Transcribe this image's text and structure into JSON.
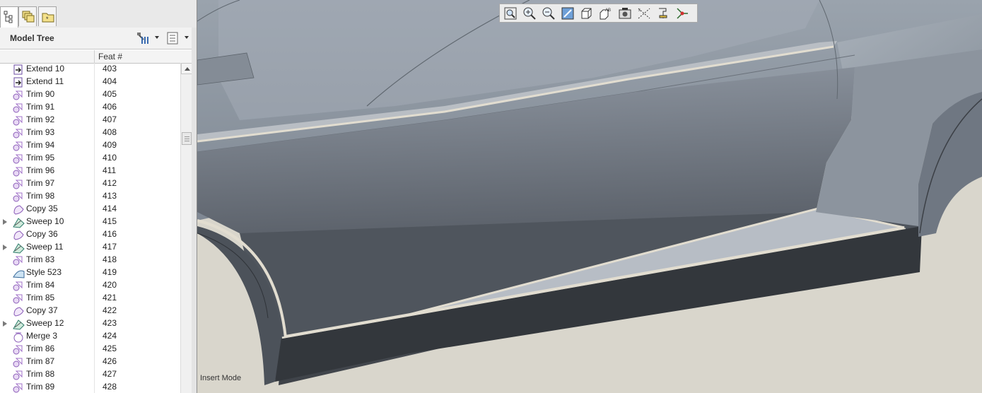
{
  "model_tree": {
    "title": "Model Tree",
    "column_header": "Feat #",
    "rows": [
      {
        "name": "Extend 10",
        "feat": "403",
        "icon": "extend-icon",
        "expandable": false
      },
      {
        "name": "Extend 11",
        "feat": "404",
        "icon": "extend-icon",
        "expandable": false
      },
      {
        "name": "Trim 90",
        "feat": "405",
        "icon": "trim-icon",
        "expandable": false
      },
      {
        "name": "Trim 91",
        "feat": "406",
        "icon": "trim-icon",
        "expandable": false
      },
      {
        "name": "Trim 92",
        "feat": "407",
        "icon": "trim-icon",
        "expandable": false
      },
      {
        "name": "Trim 93",
        "feat": "408",
        "icon": "trim-icon",
        "expandable": false
      },
      {
        "name": "Trim 94",
        "feat": "409",
        "icon": "trim-icon",
        "expandable": false
      },
      {
        "name": "Trim 95",
        "feat": "410",
        "icon": "trim-icon",
        "expandable": false
      },
      {
        "name": "Trim 96",
        "feat": "411",
        "icon": "trim-icon",
        "expandable": false
      },
      {
        "name": "Trim 97",
        "feat": "412",
        "icon": "trim-icon",
        "expandable": false
      },
      {
        "name": "Trim 98",
        "feat": "413",
        "icon": "trim-icon",
        "expandable": false
      },
      {
        "name": "Copy 35",
        "feat": "414",
        "icon": "copy-icon",
        "expandable": false
      },
      {
        "name": "Sweep 10",
        "feat": "415",
        "icon": "sweep-icon",
        "expandable": true
      },
      {
        "name": "Copy 36",
        "feat": "416",
        "icon": "copy-icon",
        "expandable": false
      },
      {
        "name": "Sweep 11",
        "feat": "417",
        "icon": "sweep-icon",
        "expandable": true
      },
      {
        "name": "Trim 83",
        "feat": "418",
        "icon": "trim-icon",
        "expandable": false
      },
      {
        "name": "Style 523",
        "feat": "419",
        "icon": "style-icon",
        "expandable": false
      },
      {
        "name": "Trim 84",
        "feat": "420",
        "icon": "trim-icon",
        "expandable": false
      },
      {
        "name": "Trim 85",
        "feat": "421",
        "icon": "trim-icon",
        "expandable": false
      },
      {
        "name": "Copy 37",
        "feat": "422",
        "icon": "copy-icon",
        "expandable": false
      },
      {
        "name": "Sweep 12",
        "feat": "423",
        "icon": "sweep-icon",
        "expandable": true
      },
      {
        "name": "Merge 3",
        "feat": "424",
        "icon": "merge-icon",
        "expandable": false
      },
      {
        "name": "Trim 86",
        "feat": "425",
        "icon": "trim-icon",
        "expandable": false
      },
      {
        "name": "Trim 87",
        "feat": "426",
        "icon": "trim-icon",
        "expandable": false
      },
      {
        "name": "Trim 88",
        "feat": "427",
        "icon": "trim-icon",
        "expandable": false
      },
      {
        "name": "Trim 89",
        "feat": "428",
        "icon": "trim-icon",
        "expandable": false
      }
    ]
  },
  "panel_tabs": [
    "model-tree-tab-icon",
    "layers-tab-icon",
    "favorites-tab-icon"
  ],
  "view_toolbar": [
    "refit-icon",
    "zoom-in-icon",
    "zoom-out-icon",
    "repaint-icon",
    "display-style-icon",
    "saved-views-icon",
    "view-manager-icon",
    "datum-display-icon",
    "annotation-display-icon",
    "spin-center-icon"
  ],
  "status": {
    "mode": "Insert Mode"
  },
  "colors": {
    "background": "#d9d6cc",
    "surface": "#7d8591",
    "edge": "#e2ddd0"
  }
}
